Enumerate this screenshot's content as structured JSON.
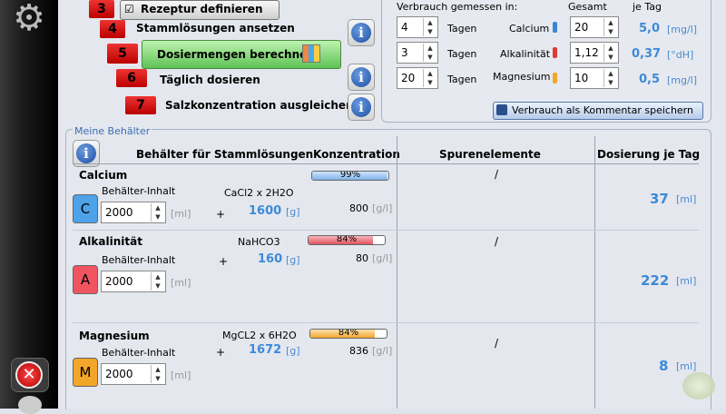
{
  "colors": {
    "accent_blue": "#3c8ad8",
    "step_red": "#d11",
    "green_button": "#6cc862"
  },
  "sidebar": {
    "settings_icon": "gear-icon",
    "close_icon": "close-icon"
  },
  "steps": [
    {
      "num": "3",
      "label": "Rezeptur definieren"
    },
    {
      "num": "4",
      "label": "Stammlösungen ansetzen"
    },
    {
      "num": "5",
      "label": "Dosiermengen berechnen"
    },
    {
      "num": "6",
      "label": "Täglich dosieren"
    },
    {
      "num": "7",
      "label": "Salzkonzentration ausgleichen"
    }
  ],
  "consumption": {
    "measured_label": "Verbrauch gemessen in:",
    "total_label": "Gesamt",
    "per_day_label": "je Tag",
    "rows": [
      {
        "days": "4",
        "days_unit": "Tagen",
        "name": "Calcium",
        "total": "20",
        "per_day": "5,0",
        "unit": "[mg/l]"
      },
      {
        "days": "3",
        "days_unit": "Tagen",
        "name": "Alkalinität",
        "total": "1,12",
        "per_day": "0,37",
        "unit": "[°dH]"
      },
      {
        "days": "20",
        "days_unit": "Tagen",
        "name": "Magnesium",
        "total": "10",
        "per_day": "0,5",
        "unit": "[mg/l]"
      }
    ],
    "save_button": "Verbrauch als Kommentar speichern"
  },
  "containers": {
    "group_title": "Meine Behälter",
    "headers": {
      "containers": "Behälter für Stammlösungen",
      "concentration": "Konzentration",
      "trace": "Spurenelemente",
      "dose": "Dosierung je Tag"
    },
    "rows": [
      {
        "name": "Calcium",
        "content_label": "Behälter-Inhalt",
        "volume": "2000",
        "volume_unit": "[ml]",
        "plus": "+",
        "compound": "CaCl2 x 2H2O",
        "amount": "1600",
        "amount_unit": "[g]",
        "conc_pct": "99%",
        "conc_value": 0.99,
        "conc_gl": "800",
        "conc_gl_unit": "[g/l]",
        "trace": "/",
        "dose": "37",
        "dose_unit": "[ml]",
        "letter": "C",
        "color": "#4ea2e8"
      },
      {
        "name": "Alkalinität",
        "content_label": "Behälter-Inhalt",
        "volume": "2000",
        "volume_unit": "[ml]",
        "plus": "+",
        "compound": "NaHCO3",
        "amount": "160",
        "amount_unit": "[g]",
        "conc_pct": "84%",
        "conc_value": 0.84,
        "conc_gl": "80",
        "conc_gl_unit": "[g/l]",
        "trace": "/",
        "dose": "222",
        "dose_unit": "[ml]",
        "letter": "A",
        "color": "#ee5561"
      },
      {
        "name": "Magnesium",
        "content_label": "Behälter-Inhalt",
        "volume": "2000",
        "volume_unit": "[ml]",
        "plus": "+",
        "compound": "MgCL2 x 6H2O",
        "amount": "1672",
        "amount_unit": "[g]",
        "conc_pct": "84%",
        "conc_value": 0.84,
        "conc_gl": "836",
        "conc_gl_unit": "[g/l]",
        "trace": "/",
        "dose": "8",
        "dose_unit": "[ml]",
        "letter": "M",
        "color": "#f2a62a"
      }
    ]
  }
}
